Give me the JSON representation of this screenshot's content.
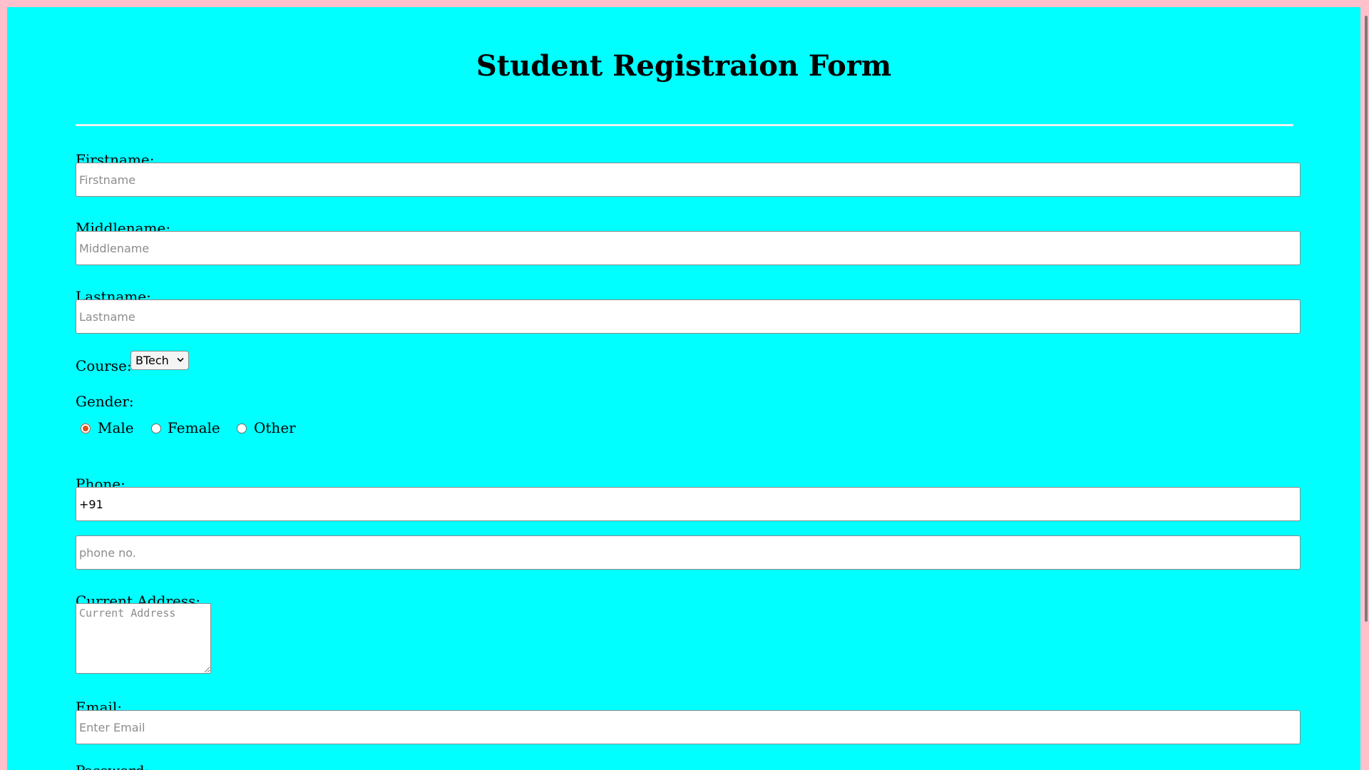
{
  "page": {
    "title": "Student Registraion Form"
  },
  "form": {
    "firstname": {
      "label": "Firstname:",
      "placeholder": "Firstname",
      "value": ""
    },
    "middlename": {
      "label": "Middlename:",
      "placeholder": "Middlename",
      "value": ""
    },
    "lastname": {
      "label": "Lastname:",
      "placeholder": "Lastname",
      "value": ""
    },
    "course": {
      "label": "Course:",
      "selected": "BTech"
    },
    "gender": {
      "label": "Gender:",
      "options": [
        {
          "label": "Male",
          "checked": true
        },
        {
          "label": "Female",
          "checked": false
        },
        {
          "label": "Other",
          "checked": false
        }
      ]
    },
    "phone": {
      "label": "Phone:",
      "code_value": "+91",
      "number_placeholder": "phone no."
    },
    "address": {
      "label": "Current Address:",
      "placeholder": "Current Address"
    },
    "email": {
      "label": "Email:",
      "placeholder": "Enter Email"
    },
    "password": {
      "label": "Password:"
    }
  },
  "colors": {
    "page_border": "#ffc0cb",
    "form_background": "#00ffff",
    "radio_accent": "#e0501e"
  },
  "icons": {
    "select_chevron": "chevron-down-icon"
  }
}
